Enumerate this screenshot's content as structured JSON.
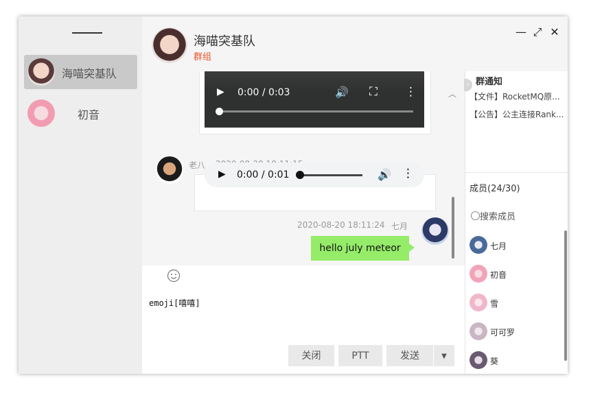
{
  "window": {
    "title": "海喵突基队",
    "subtitle": "群组"
  },
  "sidebar": {
    "items": [
      {
        "name": "海喵突基队",
        "active": true
      },
      {
        "name": "初音",
        "active": false
      }
    ]
  },
  "controls": {
    "minimize": "—",
    "maximize": "⤢",
    "close": "✕"
  },
  "messages": {
    "video": {
      "time": "0:00 / 0:03"
    },
    "msg1": {
      "sender": "老八",
      "timestamp": "2020-08-20 18:11:15",
      "audio_time": "0:00 / 0:01"
    },
    "msg2": {
      "sender": "七月",
      "timestamp": "2020-08-20 18:11:24",
      "text": "hello july meteor"
    }
  },
  "input": {
    "text": "emoji[嘻嘻]"
  },
  "buttons": {
    "close": "关闭",
    "ptt": "PTT",
    "send": "发送"
  },
  "notices": {
    "title": "群通知",
    "items": [
      "【文件】RocketMQ原...",
      "【公告】公主连接Rank..."
    ]
  },
  "members": {
    "title": "成员(24/30)",
    "search_placeholder": "搜索成员",
    "list": [
      {
        "name": "七月",
        "color": "#4a6a9a"
      },
      {
        "name": "初音",
        "color": "#f2a3b8"
      },
      {
        "name": "雪",
        "color": "#f0b7c8"
      },
      {
        "name": "可可罗",
        "color": "#c9b6c2"
      },
      {
        "name": "葵",
        "color": "#6a5a70"
      }
    ]
  },
  "colors": {
    "accent_red": "#e8552a",
    "bubble_green": "#95ec69"
  }
}
